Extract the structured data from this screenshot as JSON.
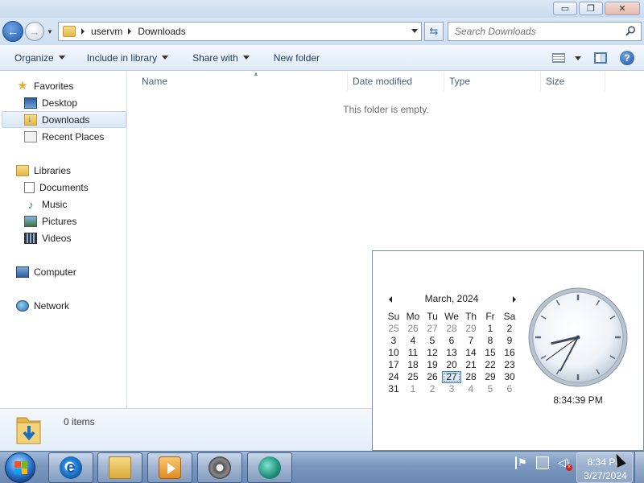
{
  "window": {
    "controls": {
      "minimize": "▭",
      "maximize": "❐",
      "close": "✕"
    }
  },
  "address": {
    "crumbs": [
      "uservm",
      "Downloads"
    ],
    "search_placeholder": "Search Downloads"
  },
  "toolbar": {
    "organize": "Organize",
    "include_in_library": "Include in library",
    "share_with": "Share with",
    "new_folder": "New folder"
  },
  "sidebar": {
    "favorites": "Favorites",
    "desktop": "Desktop",
    "downloads": "Downloads",
    "recent_places": "Recent Places",
    "libraries": "Libraries",
    "documents": "Documents",
    "music": "Music",
    "pictures": "Pictures",
    "videos": "Videos",
    "computer": "Computer",
    "network": "Network"
  },
  "content": {
    "columns": [
      "Name",
      "Date modified",
      "Type",
      "Size"
    ],
    "empty_message": "This folder is empty."
  },
  "details": {
    "items_count": "0 items"
  },
  "calendar": {
    "month_label": "March, 2024",
    "weekdays": [
      "Su",
      "Mo",
      "Tu",
      "We",
      "Th",
      "Fr",
      "Sa"
    ],
    "weeks": [
      [
        "25",
        "26",
        "27",
        "28",
        "29",
        "1",
        "2"
      ],
      [
        "3",
        "4",
        "5",
        "6",
        "7",
        "8",
        "9"
      ],
      [
        "10",
        "11",
        "12",
        "13",
        "14",
        "15",
        "16"
      ],
      [
        "17",
        "18",
        "19",
        "20",
        "21",
        "22",
        "23"
      ],
      [
        "24",
        "25",
        "26",
        "27",
        "28",
        "29",
        "30"
      ],
      [
        "31",
        "1",
        "2",
        "3",
        "4",
        "5",
        "6"
      ]
    ],
    "today": "27",
    "clock_time": "8:34:39 PM",
    "clock": {
      "hour": 8,
      "minute": 34,
      "second": 39
    }
  },
  "taskbar": {
    "apps": [
      "internet-explorer-icon",
      "windows-explorer-icon",
      "media-player-icon",
      "settings-gear-icon",
      "teal-app-icon"
    ],
    "time": "8:34 PM",
    "date": "3/27/2024"
  },
  "colors": {
    "accent": "#3b7fd1",
    "taskbar": "#7b97be"
  }
}
